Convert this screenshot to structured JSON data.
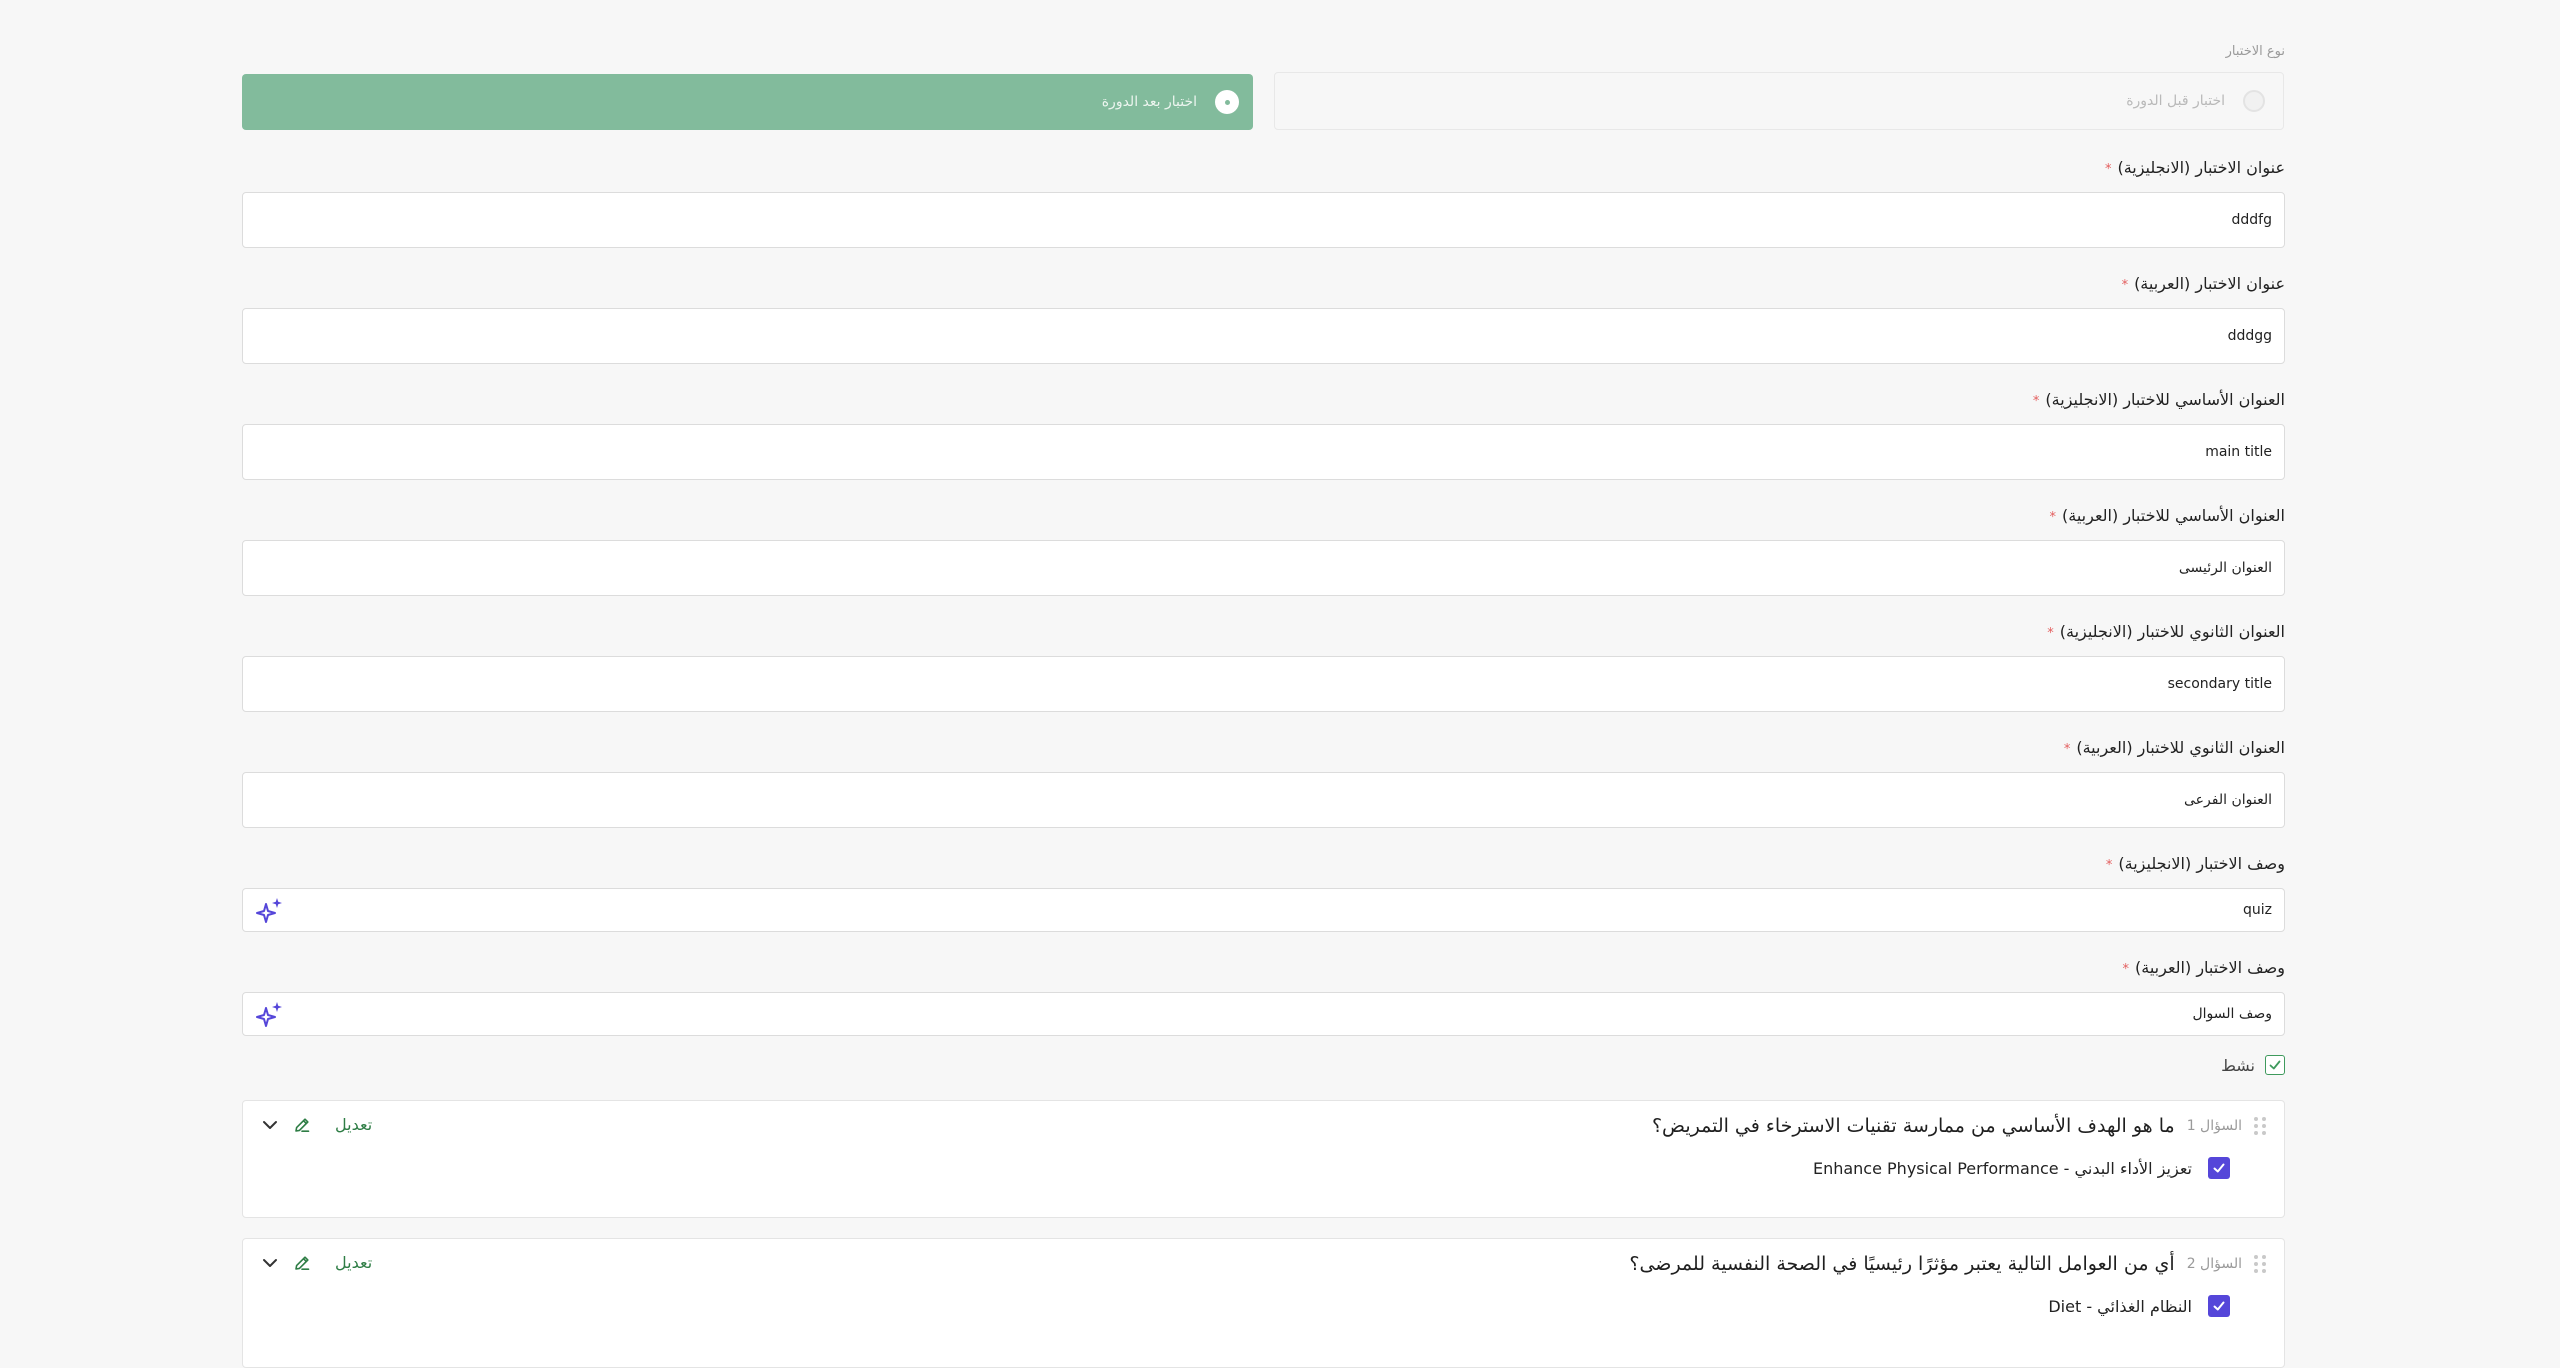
{
  "quiz_type": {
    "label": "نوع الاختبار",
    "options": [
      {
        "label": "اختبار قبل الدورة",
        "selected": false
      },
      {
        "label": "اختبار بعد الدورة",
        "selected": true
      }
    ]
  },
  "fields": [
    {
      "label": "عنوان الاختبار (الانجليزية)",
      "required_mark": "*",
      "value": "dddfg"
    },
    {
      "label": "عنوان الاختبار (العربية)",
      "required_mark": "*",
      "value": "dddgg"
    },
    {
      "label": "العنوان الأساسي للاختبار (الانجليزية)",
      "required_mark": "*",
      "value": "main title"
    },
    {
      "label": "العنوان الأساسي للاختبار (العربية)",
      "required_mark": "*",
      "value": "العنوان الرئيسى"
    },
    {
      "label": "العنوان الثانوي للاختبار (الانجليزية)",
      "required_mark": "*",
      "value": "secondary title"
    },
    {
      "label": "العنوان الثانوي للاختبار (العربية)",
      "required_mark": "*",
      "value": "العنوان الفرعى"
    },
    {
      "label": "وصف الاختبار (الانجليزية)",
      "required_mark": "*",
      "value": "quiz"
    },
    {
      "label": "وصف الاختبار (العربية)",
      "required_mark": "*",
      "value": "وصف السوال"
    }
  ],
  "active": {
    "label": "نشط",
    "checked": true
  },
  "questions": [
    {
      "number_label": "السؤال 1",
      "text": "ما هو الهدف الأساسي من ممارسة تقنيات الاسترخاء في التمريض؟",
      "edit_label": "تعديل",
      "answer": "تعزيز الأداء البدني - Enhance Physical Performance"
    },
    {
      "number_label": "السؤال 2",
      "text": "أي من العوامل التالية يعتبر مؤثرًا رئيسيًا في الصحة النفسية للمرضى؟",
      "edit_label": "تعديل",
      "answer": "النظام الغذائي - Diet"
    }
  ],
  "colors": {
    "selected_option": "#82bb9c",
    "checkbox": "#5546d9",
    "edit_green": "#2e7d45",
    "required": "#e35d5d",
    "ai_icon": "#5546d9"
  },
  "icons": {
    "ai": "sparkle-icon",
    "edit": "pencil-icon",
    "expand": "chevron-down-icon",
    "drag": "drag-handle-icon"
  }
}
